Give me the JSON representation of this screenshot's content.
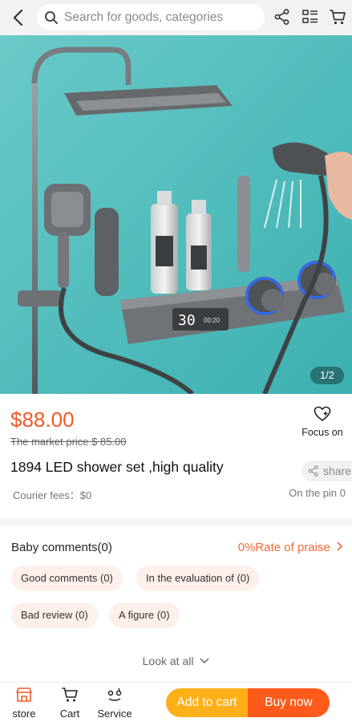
{
  "search": {
    "placeholder": "Search for goods, categories"
  },
  "hero": {
    "pager": "1/2"
  },
  "product": {
    "price": "$88.00",
    "market_price": "The market price $ 85.00",
    "focus_label": "Focus on",
    "title": "1894 LED shower set ,high quality",
    "share_label": "share",
    "courier_fees": "Courier fees：$0",
    "on_the_pin": "On the pin 0"
  },
  "comments": {
    "title": "Baby comments(0)",
    "praise": "0%Rate of praise",
    "tags": [
      "Good comments (0)",
      "In the evaluation of (0)",
      "Bad review (0)",
      "A figure (0)"
    ],
    "look_at_all": "Look at all"
  },
  "bottom_nav": {
    "store": "store",
    "cart": "Cart",
    "service": "Service",
    "add_to_cart": "Add to cart",
    "buy_now": "Buy now"
  },
  "colors": {
    "price": "#f05a2a",
    "add_to_cart": "#ffb018",
    "buy_now": "#ff5a1a",
    "tag_bg": "#fdf0ea"
  }
}
